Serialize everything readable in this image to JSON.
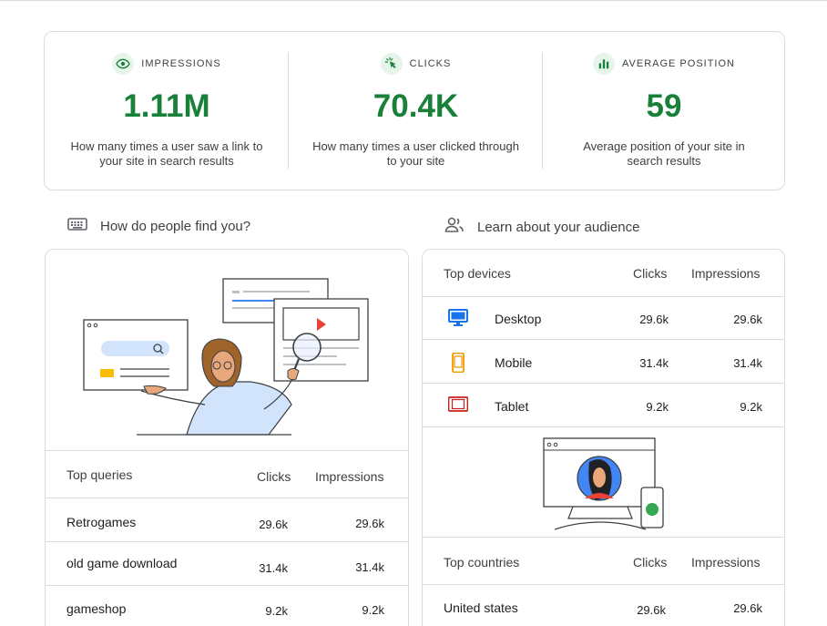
{
  "stats": [
    {
      "label": "IMPRESSIONS",
      "icon": "eye-icon",
      "value": "1.11M",
      "desc": "How many times a user saw a link to your site in search results"
    },
    {
      "label": "CLICKS",
      "icon": "cursor-click-icon",
      "value": "70.4K",
      "desc": "How many times a user clicked through to your site"
    },
    {
      "label": "AVERAGE POSITION",
      "icon": "bar-chart-icon",
      "value": "59",
      "desc": "Average position of your site in search results"
    }
  ],
  "sections": {
    "left_title": "How do people find you?",
    "right_title": "Learn about your audience"
  },
  "queries": {
    "header": {
      "name": "Top queries",
      "clicks": "Clicks",
      "impressions": "Impressions"
    },
    "rows": [
      {
        "name": "Retrogames",
        "clicks": "29.6k",
        "impressions": "29.6k"
      },
      {
        "name": "old game download",
        "clicks": "31.4k",
        "impressions": "31.4k"
      },
      {
        "name": "gameshop",
        "clicks": "9.2k",
        "impressions": "9.2k"
      }
    ]
  },
  "devices": {
    "header": {
      "name": "Top devices",
      "clicks": "Clicks",
      "impressions": "Impressions"
    },
    "rows": [
      {
        "name": "Desktop",
        "icon": "desktop-icon",
        "color": "#1a73e8",
        "clicks": "29.6k",
        "impressions": "29.6k"
      },
      {
        "name": "Mobile",
        "icon": "mobile-icon",
        "color": "#f29900",
        "clicks": "31.4k",
        "impressions": "31.4k"
      },
      {
        "name": "Tablet",
        "icon": "tablet-icon",
        "color": "#c5221f",
        "clicks": "9.2k",
        "impressions": "9.2k"
      }
    ]
  },
  "countries": {
    "header": {
      "name": "Top countries",
      "clicks": "Clicks",
      "impressions": "Impressions"
    },
    "rows": [
      {
        "name": "United states",
        "clicks": "29.6k",
        "impressions": "29.6k"
      }
    ]
  },
  "colors": {
    "accent_green": "#188038",
    "border": "#dadce0",
    "text": "#3c4043"
  }
}
